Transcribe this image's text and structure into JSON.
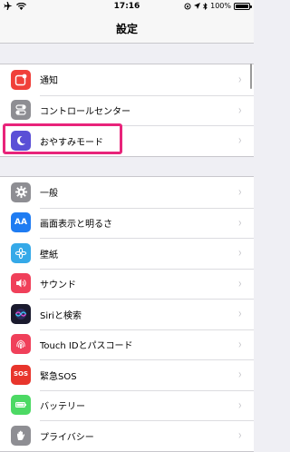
{
  "status_bar": {
    "time": "17:16",
    "battery": "100%"
  },
  "nav": {
    "title": "設定"
  },
  "group1": [
    {
      "label": "通知",
      "icon": "notifications-icon",
      "color": "#f0403a"
    },
    {
      "label": "コントロールセンター",
      "icon": "control-center-icon",
      "color": "#8e8e93"
    },
    {
      "label": "おやすみモード",
      "icon": "moon-icon",
      "color": "#5a4fd6"
    }
  ],
  "group2": [
    {
      "label": "一般",
      "icon": "gear-icon",
      "color": "#8e8e93"
    },
    {
      "label": "画面表示と明るさ",
      "icon": "display-brightness-icon",
      "glyph": "AA",
      "color": "#1f7cf2"
    },
    {
      "label": "壁紙",
      "icon": "wallpaper-icon",
      "color": "#35a9e8"
    },
    {
      "label": "サウンド",
      "icon": "sound-icon",
      "color": "#f0405a"
    },
    {
      "label": "Siriと検索",
      "icon": "siri-icon",
      "color": "#1a1a2e"
    },
    {
      "label": "Touch IDとパスコード",
      "icon": "fingerprint-icon",
      "color": "#f0405a"
    },
    {
      "label": "緊急SOS",
      "icon": "sos-icon",
      "glyph": "SOS",
      "color": "#e8352c"
    },
    {
      "label": "バッテリー",
      "icon": "battery-icon",
      "color": "#4cd964"
    },
    {
      "label": "プライバシー",
      "icon": "hand-icon",
      "color": "#8e8e93"
    }
  ],
  "chevron": "›"
}
